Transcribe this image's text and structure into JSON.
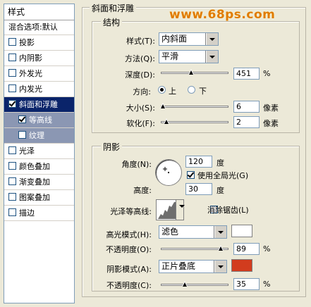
{
  "sidebar": {
    "header": "样式",
    "items": [
      {
        "label": "混合选项:默认",
        "checkbox": false,
        "checked": false,
        "state": "normal"
      },
      {
        "label": "投影",
        "checkbox": true,
        "checked": false,
        "state": "normal"
      },
      {
        "label": "内阴影",
        "checkbox": true,
        "checked": false,
        "state": "normal"
      },
      {
        "label": "外发光",
        "checkbox": true,
        "checked": false,
        "state": "normal"
      },
      {
        "label": "内发光",
        "checkbox": true,
        "checked": false,
        "state": "normal"
      },
      {
        "label": "斜面和浮雕",
        "checkbox": true,
        "checked": true,
        "state": "selected"
      },
      {
        "label": "等高线",
        "checkbox": true,
        "checked": true,
        "state": "sub-selected"
      },
      {
        "label": "纹理",
        "checkbox": true,
        "checked": false,
        "state": "sub"
      },
      {
        "label": "光泽",
        "checkbox": true,
        "checked": false,
        "state": "normal"
      },
      {
        "label": "颜色叠加",
        "checkbox": true,
        "checked": false,
        "state": "normal"
      },
      {
        "label": "渐变叠加",
        "checkbox": true,
        "checked": false,
        "state": "normal"
      },
      {
        "label": "图案叠加",
        "checkbox": true,
        "checked": false,
        "state": "normal"
      },
      {
        "label": "描边",
        "checkbox": true,
        "checked": false,
        "state": "normal"
      }
    ]
  },
  "watermark": "www.68ps.com",
  "bevel": {
    "title": "斜面和浮雕",
    "structure": {
      "title": "结构",
      "style_label": "样式(T):",
      "style_value": "内斜面",
      "technique_label": "方法(Q):",
      "technique_value": "平滑",
      "depth_label": "深度(D):",
      "depth_value": "451",
      "depth_unit": "%",
      "depth_fraction": 0.45,
      "direction_label": "方向:",
      "direction_up": "上",
      "direction_down": "下",
      "direction_selected": "up",
      "size_label": "大小(S):",
      "size_value": "6",
      "size_unit": "像素",
      "size_fraction": 0.03,
      "soften_label": "软化(F):",
      "soften_value": "2",
      "soften_unit": "像素",
      "soften_fraction": 0.08
    },
    "shading": {
      "title": "阴影",
      "angle_label": "角度(N):",
      "angle_value": "120",
      "angle_unit": "度",
      "global_light_label": "使用全局光(G)",
      "global_light_checked": true,
      "altitude_label": "高度:",
      "altitude_value": "30",
      "altitude_unit": "度",
      "gloss_contour_label": "光泽等高线:",
      "antialias_label": "消除锯齿(L)",
      "antialias_checked": false,
      "highlight_mode_label": "高光模式(H):",
      "highlight_mode_value": "滤色",
      "highlight_color": "#ffffff",
      "highlight_opacity_label": "不透明度(O):",
      "highlight_opacity_value": "89",
      "highlight_opacity_unit": "%",
      "highlight_opacity_fraction": 0.89,
      "shadow_mode_label": "阴影模式(A):",
      "shadow_mode_value": "正片叠底",
      "shadow_color": "#d23c1e",
      "shadow_opacity_label": "不透明度(C):",
      "shadow_opacity_value": "35",
      "shadow_opacity_unit": "%",
      "shadow_opacity_fraction": 0.35
    }
  }
}
